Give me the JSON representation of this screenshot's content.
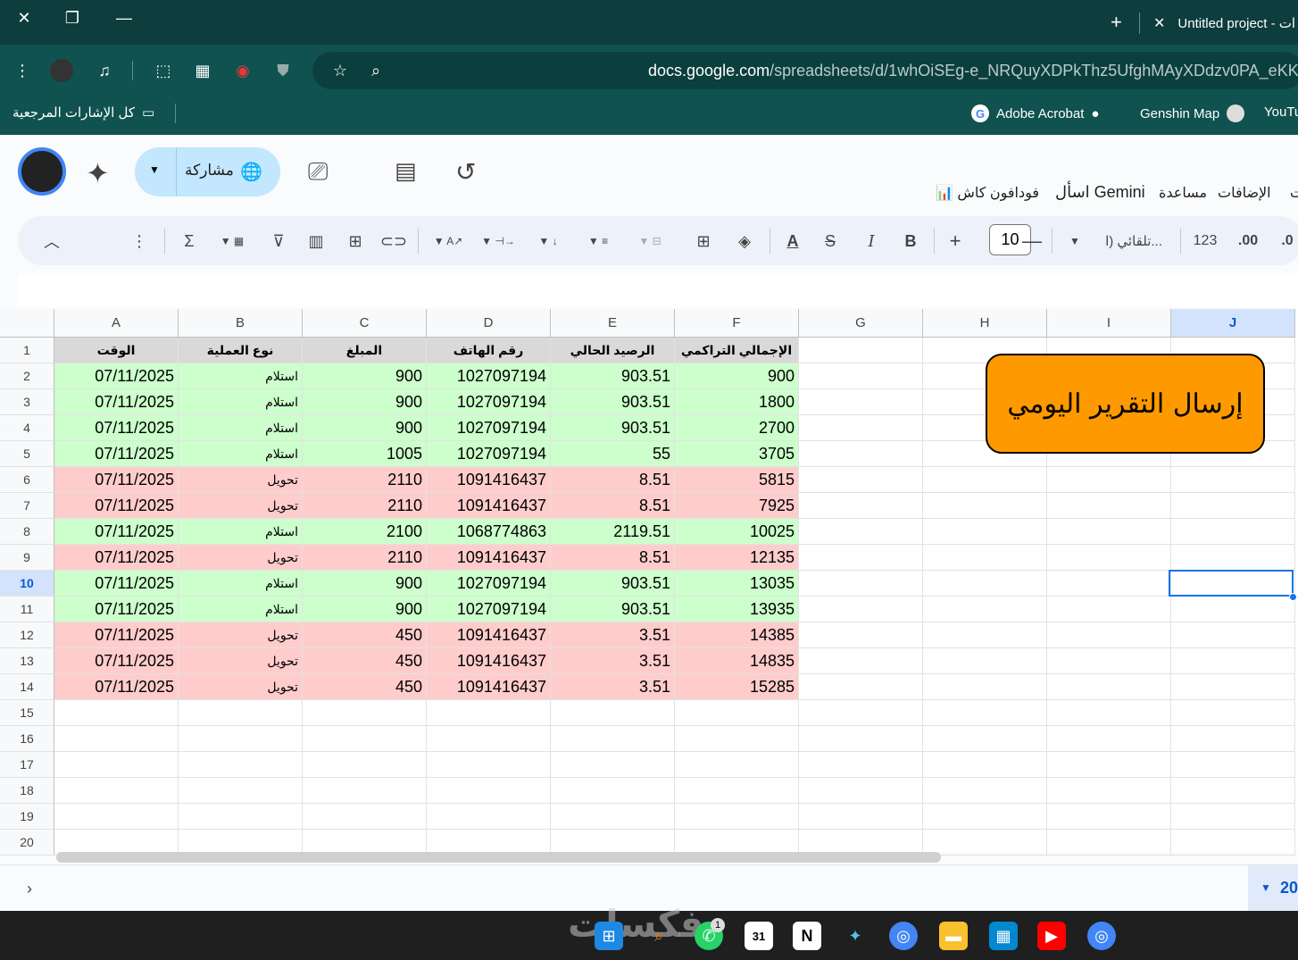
{
  "browser": {
    "tab_title": "Untitled project - ات",
    "url_domain": "docs.google.com",
    "url_path": "/spreadsheets/d/1whOiSEg-e_NRQuyXDPkThz5UfghMAyXDdzv0PA_eKK0/edit"
  },
  "bookmarks": {
    "all_bookmarks": "كل الإشارات المرجعية",
    "items": [
      "Adobe Acrobat",
      "Genshin Map",
      "YouTu"
    ]
  },
  "sheets_header": {
    "share_label": "مشاركة",
    "menu": [
      "ت",
      "الإضافات",
      "مساعدة",
      "اسأل Gemini",
      "📊 فودافون كاش"
    ]
  },
  "toolbar": {
    "font_size": "10",
    "font_name": "تلقائي (ا...",
    "number_format": "123",
    "decimal_more": ".00",
    "decimal_less": ".0"
  },
  "columns": [
    "A",
    "B",
    "C",
    "D",
    "E",
    "F",
    "G",
    "H",
    "I",
    "J"
  ],
  "selected_column": "J",
  "selected_row": "10",
  "rows": [
    "1",
    "2",
    "3",
    "4",
    "5",
    "6",
    "7",
    "8",
    "9",
    "10",
    "11",
    "12",
    "13",
    "14",
    "15",
    "16",
    "17",
    "18",
    "19",
    "20"
  ],
  "table": {
    "headers": [
      "الوقت",
      "نوع العملية",
      "المبلغ",
      "رقم الهاتف",
      "الرصيد الحالي",
      "الإجمالي التراكمي"
    ],
    "data": [
      [
        "07/11/2025",
        "استلام",
        "900",
        "1027097194",
        "903.51",
        "900",
        "green"
      ],
      [
        "07/11/2025",
        "استلام",
        "900",
        "1027097194",
        "903.51",
        "1800",
        "green"
      ],
      [
        "07/11/2025",
        "استلام",
        "900",
        "1027097194",
        "903.51",
        "2700",
        "green"
      ],
      [
        "07/11/2025",
        "استلام",
        "1005",
        "1027097194",
        "55",
        "3705",
        "green"
      ],
      [
        "07/11/2025",
        "تحويل",
        "2110",
        "1091416437",
        "8.51",
        "5815",
        "red"
      ],
      [
        "07/11/2025",
        "تحويل",
        "2110",
        "1091416437",
        "8.51",
        "7925",
        "red"
      ],
      [
        "07/11/2025",
        "استلام",
        "2100",
        "1068774863",
        "2119.51",
        "10025",
        "green"
      ],
      [
        "07/11/2025",
        "تحويل",
        "2110",
        "1091416437",
        "8.51",
        "12135",
        "red"
      ],
      [
        "07/11/2025",
        "استلام",
        "900",
        "1027097194",
        "903.51",
        "13035",
        "green"
      ],
      [
        "07/11/2025",
        "استلام",
        "900",
        "1027097194",
        "903.51",
        "13935",
        "green"
      ],
      [
        "07/11/2025",
        "تحويل",
        "450",
        "1091416437",
        "3.51",
        "14385",
        "red"
      ],
      [
        "07/11/2025",
        "تحويل",
        "450",
        "1091416437",
        "3.51",
        "14835",
        "red"
      ],
      [
        "07/11/2025",
        "تحويل",
        "450",
        "1091416437",
        "3.51",
        "15285",
        "red"
      ]
    ]
  },
  "report_button": "إرسال التقرير اليومي",
  "sheet_tab_partial": "20",
  "taskbar": {
    "watermark": "فكسات",
    "whatsapp_badge": "1",
    "calendar_day": "31"
  },
  "colors": {
    "green_row": "#ccffcc",
    "red_row": "#ffcccc",
    "button": "#ff9900",
    "chrome": "#10524f"
  }
}
